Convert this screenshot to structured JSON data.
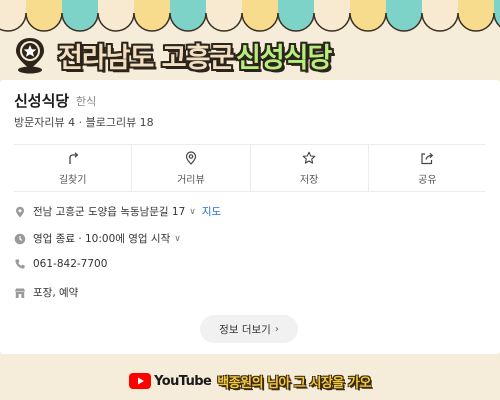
{
  "banner": {
    "region": "전라남도 고흥군",
    "place": "신성식당",
    "icon": "map-pin-star-icon"
  },
  "place": {
    "name": "신성식당",
    "category": "한식",
    "reviews": "방문자리뷰 4 · 블로그리뷰 18"
  },
  "actions": [
    {
      "label": "길찾기",
      "icon": "directions-icon"
    },
    {
      "label": "거리뷰",
      "icon": "location-pin-icon"
    },
    {
      "label": "저장",
      "icon": "star-icon"
    },
    {
      "label": "공유",
      "icon": "share-icon"
    }
  ],
  "info": {
    "address": "전남 고흥군 도양읍 녹동남문길 17",
    "map_link": "지도",
    "hours": "영업 종료 · 10:00에 영업 시작",
    "phone": "061-842-7700",
    "options": "포장, 예약"
  },
  "more_button": "정보 더보기",
  "footer": {
    "platform": "YouTube",
    "channel": "백종원의 님아 그 시장을 가오"
  },
  "colors": {
    "awning_yellow": "#f6dc8c",
    "awning_teal": "#7ed3c9",
    "awning_cream": "#f7ead0",
    "accent_green": "#b6ef7d",
    "link_blue": "#2a6edb",
    "youtube_red": "#ff0000",
    "channel_yellow": "#f2c93b"
  }
}
